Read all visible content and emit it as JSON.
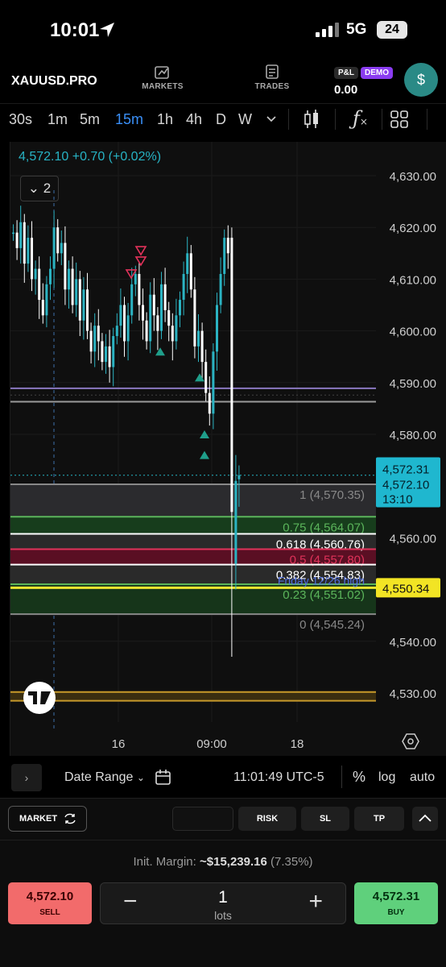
{
  "status": {
    "time": "10:01",
    "network": "5G",
    "battery": "24"
  },
  "header": {
    "symbol": "XAUUSD.PRO",
    "nav": [
      {
        "label": "MARKETS",
        "icon": "markets-icon"
      },
      {
        "label": "TRADES",
        "icon": "trades-icon"
      }
    ],
    "pl_label": "P&L",
    "demo_label": "DEMO",
    "pl_value": "0.00",
    "account_icon": "$"
  },
  "timeframes": [
    "30s",
    "1m",
    "5m",
    "15m",
    "1h",
    "4h",
    "D",
    "W"
  ],
  "active_timeframe": "15m",
  "toolbar_icons": [
    "chevron-down-icon",
    "candles-icon",
    "indicators-icon",
    "layouts-icon"
  ],
  "chart": {
    "quote": "4,572.10  +0.70 (+0.02%)",
    "collapse_count": "2",
    "y_axis_ticks": [
      "4,630.00",
      "4,620.00",
      "4,610.00",
      "4,600.00",
      "4,590.00",
      "4,580.00",
      "4,560.00",
      "4,540.00",
      "4,530.00"
    ],
    "x_axis_ticks": [
      "16",
      "09:00",
      "18"
    ],
    "ask_label": "4,572.31",
    "bid_label": "4,572.10",
    "countdown": "13:10",
    "level_label": "4,550.34",
    "fib_levels": [
      {
        "label": "1 (4,570.35)",
        "color": "#888888"
      },
      {
        "label": "0.75 (4,564.07)",
        "color": "#5bb55b"
      },
      {
        "label": "0.618 (4,560.76)",
        "color": "#ffffff"
      },
      {
        "label": "0.5 (4,557.80)",
        "color": "#e0325a"
      },
      {
        "label": "0.382 (4,554.83)",
        "color": "#ffffff"
      },
      {
        "label": "0.23 (4,551.02)",
        "color": "#5bb55b"
      },
      {
        "label": "0 (4,545.24)",
        "color": "#888888"
      }
    ],
    "annotation": "Friday 12/26 high",
    "colors": {
      "up": "#2bb3c2",
      "down": "#ffffff",
      "accent": "#3a8ff7",
      "marker_up": "#1f9e8a",
      "marker_down": "#e0325a"
    }
  },
  "strip": {
    "date_range": "Date Range",
    "clock": "11:01:49 UTC-5",
    "percent": "%",
    "log": "log",
    "auto": "auto"
  },
  "order": {
    "type_label": "MARKET",
    "buttons": [
      "RISK",
      "SL",
      "TP"
    ],
    "margin_label": "Init. Margin:",
    "margin_value": "~$15,239.16",
    "margin_pct": "(7.35%)",
    "sell_price": "4,572.10",
    "sell_label": "SELL",
    "buy_price": "4,572.31",
    "buy_label": "BUY",
    "quantity": "1",
    "quantity_unit": "lots"
  }
}
